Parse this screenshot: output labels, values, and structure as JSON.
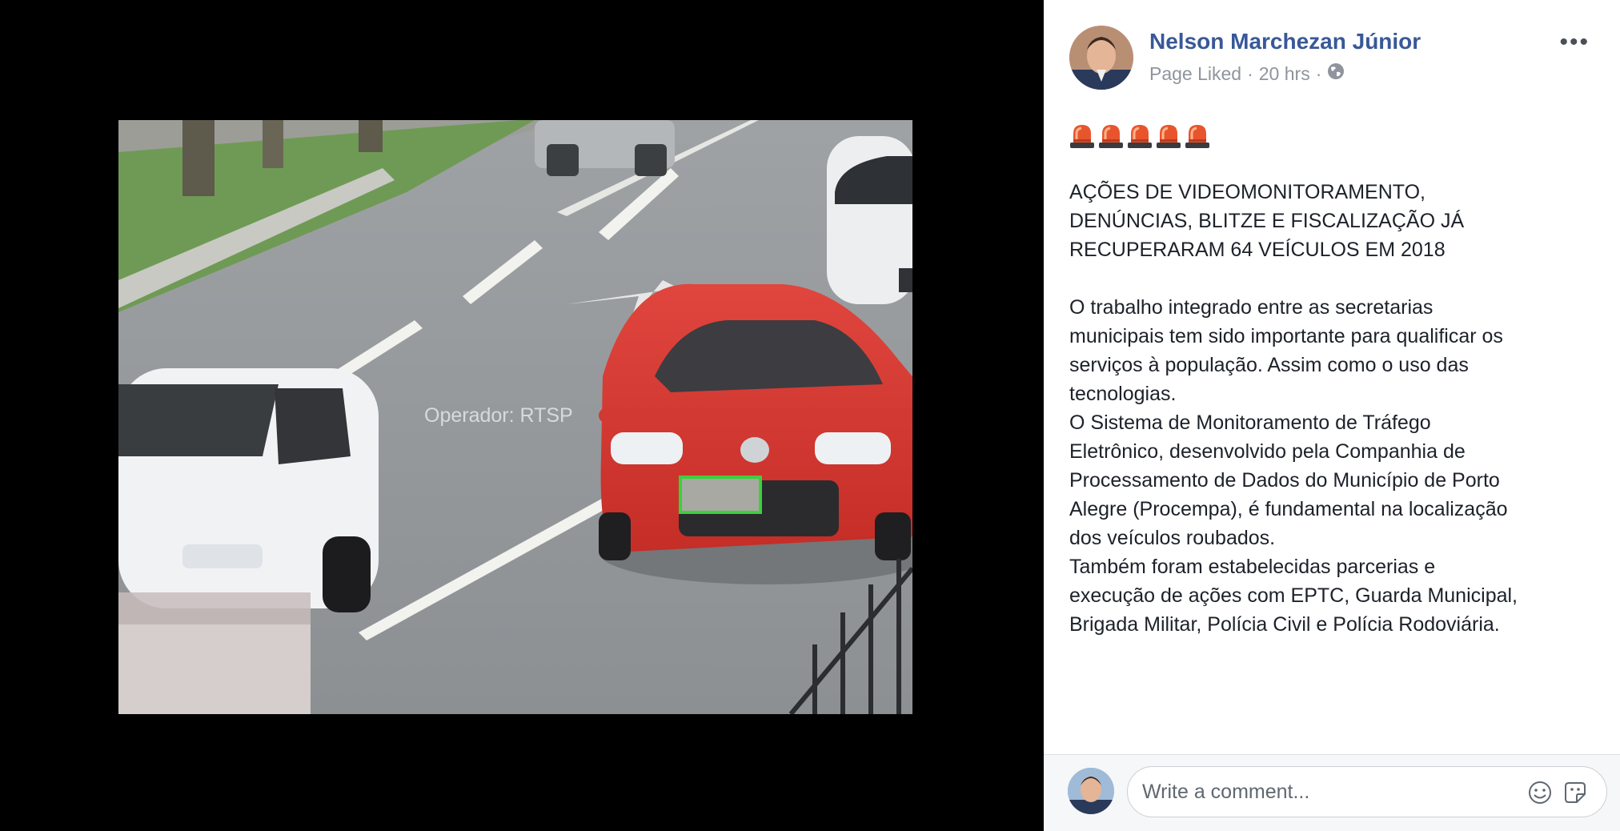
{
  "photo": {
    "overlay_text": "Operador: RTSP",
    "highlight_color": "#3bd13b"
  },
  "post": {
    "author": "Nelson Marchezan Júnior",
    "status": "Page Liked",
    "time": "20 hrs",
    "separator": "·",
    "audience_icon": "globe-icon",
    "more_label": "•••",
    "emoji_icon": "police-siren-icon",
    "emoji_count": 5,
    "headline": [
      "AÇÕES DE VIDEOMONITORAMENTO,",
      "DENÚNCIAS, BLITZE E FISCALIZAÇÃO JÁ",
      "RECUPERARAM 64 VEÍCULOS EM 2018"
    ],
    "body": [
      "O trabalho integrado entre as secretarias",
      "municipais tem sido importante para qualificar os",
      "serviços à população. Assim como o uso das",
      "tecnologias.",
      "O Sistema de Monitoramento de Tráfego",
      "Eletrônico, desenvolvido pela Companhia de",
      "Processamento de Dados do Município de Porto",
      "Alegre (Procempa), é fundamental na localização",
      "dos veículos roubados.",
      "Também foram estabelecidas parcerias e",
      "execução de ações com EPTC, Guarda Municipal,",
      "Brigada Militar, Polícia Civil e Polícia Rodoviária."
    ]
  },
  "composer": {
    "placeholder": "Write a comment...",
    "icons": [
      "smiley-icon",
      "sticker-icon"
    ]
  },
  "colors": {
    "link": "#385898",
    "meta": "#90949c",
    "text": "#1d2129"
  }
}
